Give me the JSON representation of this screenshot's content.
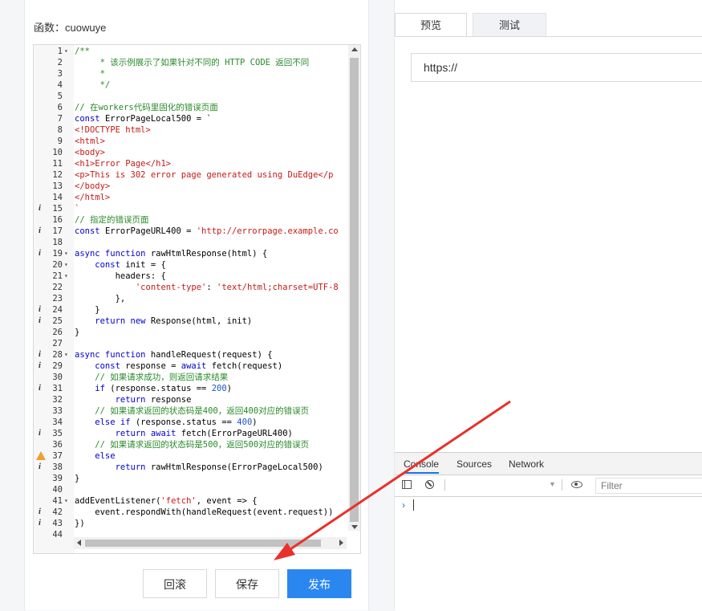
{
  "function": {
    "label": "函数：",
    "name": "cuowuye"
  },
  "editor": {
    "lines": [
      {
        "n": "1",
        "fold": "▾",
        "mark": "",
        "segs": [
          {
            "t": "/**",
            "c": "c-com"
          }
        ]
      },
      {
        "n": "2",
        "fold": "",
        "mark": "",
        "segs": [
          {
            "t": "     * 该示例展示了如果针对不同的 HTTP CODE 返回不同",
            "c": "c-com"
          }
        ]
      },
      {
        "n": "3",
        "fold": "",
        "mark": "",
        "segs": [
          {
            "t": "     *",
            "c": "c-com"
          }
        ]
      },
      {
        "n": "4",
        "fold": "",
        "mark": "",
        "segs": [
          {
            "t": "     */",
            "c": "c-com"
          }
        ]
      },
      {
        "n": "5",
        "fold": "",
        "mark": "",
        "segs": []
      },
      {
        "n": "6",
        "fold": "",
        "mark": "",
        "segs": [
          {
            "t": "// 在workers代码里固化的错误页面",
            "c": "c-com"
          }
        ]
      },
      {
        "n": "7",
        "fold": "",
        "mark": "",
        "segs": [
          {
            "t": "const ",
            "c": "c-kw"
          },
          {
            "t": "ErrorPageLocal500 = `",
            "c": "c-plain"
          }
        ]
      },
      {
        "n": "8",
        "fold": "",
        "mark": "",
        "segs": [
          {
            "t": "<!DOCTYPE html>",
            "c": "c-str"
          }
        ]
      },
      {
        "n": "9",
        "fold": "",
        "mark": "",
        "segs": [
          {
            "t": "<html>",
            "c": "c-str"
          }
        ]
      },
      {
        "n": "10",
        "fold": "",
        "mark": "",
        "segs": [
          {
            "t": "<body>",
            "c": "c-str"
          }
        ]
      },
      {
        "n": "11",
        "fold": "",
        "mark": "",
        "segs": [
          {
            "t": "<h1>Error Page</h1>",
            "c": "c-str"
          }
        ]
      },
      {
        "n": "12",
        "fold": "",
        "mark": "",
        "segs": [
          {
            "t": "<p>This is 302 error page generated using DuEdge</p",
            "c": "c-str"
          }
        ]
      },
      {
        "n": "13",
        "fold": "",
        "mark": "",
        "segs": [
          {
            "t": "</body>",
            "c": "c-str"
          }
        ]
      },
      {
        "n": "14",
        "fold": "",
        "mark": "",
        "segs": [
          {
            "t": "</html>",
            "c": "c-str"
          }
        ]
      },
      {
        "n": "15",
        "fold": "",
        "mark": "i",
        "segs": [
          {
            "t": "`",
            "c": "c-str"
          }
        ]
      },
      {
        "n": "16",
        "fold": "",
        "mark": "",
        "segs": [
          {
            "t": "// 指定的错误页面",
            "c": "c-com"
          }
        ]
      },
      {
        "n": "17",
        "fold": "",
        "mark": "i",
        "segs": [
          {
            "t": "const ",
            "c": "c-kw"
          },
          {
            "t": "ErrorPageURL400 = ",
            "c": "c-plain"
          },
          {
            "t": "'http://errorpage.example.co",
            "c": "c-str"
          }
        ]
      },
      {
        "n": "18",
        "fold": "",
        "mark": "",
        "segs": []
      },
      {
        "n": "19",
        "fold": "▾",
        "mark": "i",
        "segs": [
          {
            "t": "async function ",
            "c": "c-kw"
          },
          {
            "t": "rawHtmlResponse(html) {",
            "c": "c-plain"
          }
        ]
      },
      {
        "n": "20",
        "fold": "▾",
        "mark": "",
        "segs": [
          {
            "t": "    const ",
            "c": "c-kw"
          },
          {
            "t": "init = {",
            "c": "c-plain"
          }
        ]
      },
      {
        "n": "21",
        "fold": "▾",
        "mark": "",
        "segs": [
          {
            "t": "        headers: {",
            "c": "c-plain"
          }
        ]
      },
      {
        "n": "22",
        "fold": "",
        "mark": "",
        "segs": [
          {
            "t": "            'content-type'",
            "c": "c-str"
          },
          {
            "t": ": ",
            "c": "c-plain"
          },
          {
            "t": "'text/html;charset=UTF-8",
            "c": "c-str"
          }
        ]
      },
      {
        "n": "23",
        "fold": "",
        "mark": "",
        "segs": [
          {
            "t": "        },",
            "c": "c-plain"
          }
        ]
      },
      {
        "n": "24",
        "fold": "",
        "mark": "i",
        "segs": [
          {
            "t": "    }",
            "c": "c-plain"
          }
        ]
      },
      {
        "n": "25",
        "fold": "",
        "mark": "i",
        "segs": [
          {
            "t": "    return new ",
            "c": "c-kw"
          },
          {
            "t": "Response(html, init)",
            "c": "c-plain"
          }
        ]
      },
      {
        "n": "26",
        "fold": "",
        "mark": "",
        "segs": [
          {
            "t": "}",
            "c": "c-plain"
          }
        ]
      },
      {
        "n": "27",
        "fold": "",
        "mark": "",
        "segs": []
      },
      {
        "n": "28",
        "fold": "▾",
        "mark": "i",
        "segs": [
          {
            "t": "async function ",
            "c": "c-kw"
          },
          {
            "t": "handleRequest(request) {",
            "c": "c-plain"
          }
        ]
      },
      {
        "n": "29",
        "fold": "",
        "mark": "i",
        "segs": [
          {
            "t": "    const ",
            "c": "c-kw"
          },
          {
            "t": "response = ",
            "c": "c-plain"
          },
          {
            "t": "await ",
            "c": "c-kw"
          },
          {
            "t": "fetch(request)",
            "c": "c-plain"
          }
        ]
      },
      {
        "n": "30",
        "fold": "",
        "mark": "",
        "segs": [
          {
            "t": "    // 如果请求成功，则返回请求结果",
            "c": "c-com"
          }
        ]
      },
      {
        "n": "31",
        "fold": "",
        "mark": "i",
        "segs": [
          {
            "t": "    if ",
            "c": "c-kw"
          },
          {
            "t": "(response.status == ",
            "c": "c-plain"
          },
          {
            "t": "200",
            "c": "c-num"
          },
          {
            "t": ")",
            "c": "c-plain"
          }
        ]
      },
      {
        "n": "32",
        "fold": "",
        "mark": "",
        "segs": [
          {
            "t": "        return ",
            "c": "c-kw"
          },
          {
            "t": "response",
            "c": "c-plain"
          }
        ]
      },
      {
        "n": "33",
        "fold": "",
        "mark": "",
        "segs": [
          {
            "t": "    // 如果请求返回的状态码是400，返回400对应的错误页",
            "c": "c-com"
          }
        ]
      },
      {
        "n": "34",
        "fold": "",
        "mark": "",
        "segs": [
          {
            "t": "    else if ",
            "c": "c-kw"
          },
          {
            "t": "(response.status == ",
            "c": "c-plain"
          },
          {
            "t": "400",
            "c": "c-num"
          },
          {
            "t": ")",
            "c": "c-plain"
          }
        ]
      },
      {
        "n": "35",
        "fold": "",
        "mark": "i",
        "segs": [
          {
            "t": "        return await ",
            "c": "c-kw"
          },
          {
            "t": "fetch(ErrorPageURL400)",
            "c": "c-plain"
          }
        ]
      },
      {
        "n": "36",
        "fold": "",
        "mark": "",
        "segs": [
          {
            "t": "    // 如果请求返回的状态码是500，返回500对应的错误页",
            "c": "c-com"
          }
        ]
      },
      {
        "n": "37",
        "fold": "",
        "mark": "warn",
        "segs": [
          {
            "t": "    else",
            "c": "c-kw"
          }
        ]
      },
      {
        "n": "38",
        "fold": "",
        "mark": "i",
        "segs": [
          {
            "t": "        return ",
            "c": "c-kw"
          },
          {
            "t": "rawHtmlResponse(ErrorPageLocal500)",
            "c": "c-plain"
          }
        ]
      },
      {
        "n": "39",
        "fold": "",
        "mark": "",
        "segs": [
          {
            "t": "}",
            "c": "c-plain"
          }
        ]
      },
      {
        "n": "40",
        "fold": "",
        "mark": "",
        "segs": []
      },
      {
        "n": "41",
        "fold": "▾",
        "mark": "",
        "segs": [
          {
            "t": "addEventListener(",
            "c": "c-plain"
          },
          {
            "t": "'fetch'",
            "c": "c-str"
          },
          {
            "t": ", event => {",
            "c": "c-plain"
          }
        ]
      },
      {
        "n": "42",
        "fold": "",
        "mark": "i",
        "segs": [
          {
            "t": "    event.respondWith(handleRequest(event.request))",
            "c": "c-plain"
          }
        ]
      },
      {
        "n": "43",
        "fold": "",
        "mark": "i",
        "segs": [
          {
            "t": "})",
            "c": "c-plain"
          }
        ]
      },
      {
        "n": "44",
        "fold": "",
        "mark": "",
        "segs": [
          {
            "t": "",
            "c": "c-plain"
          }
        ]
      }
    ]
  },
  "buttons": {
    "rollback": "回滚",
    "save": "保存",
    "publish": "发布"
  },
  "preview": {
    "tabs": [
      "预览",
      "测试"
    ],
    "url_value": "https://"
  },
  "devtools": {
    "tabs": [
      "Console",
      "Sources",
      "Network"
    ],
    "filter_placeholder": "Filter",
    "prompt": "›"
  },
  "colors": {
    "primary": "#2b87f0",
    "annotation_arrow": "#e8312a",
    "comment": "#2a8a2a",
    "keyword": "#0000cc",
    "string": "#c41a16"
  }
}
